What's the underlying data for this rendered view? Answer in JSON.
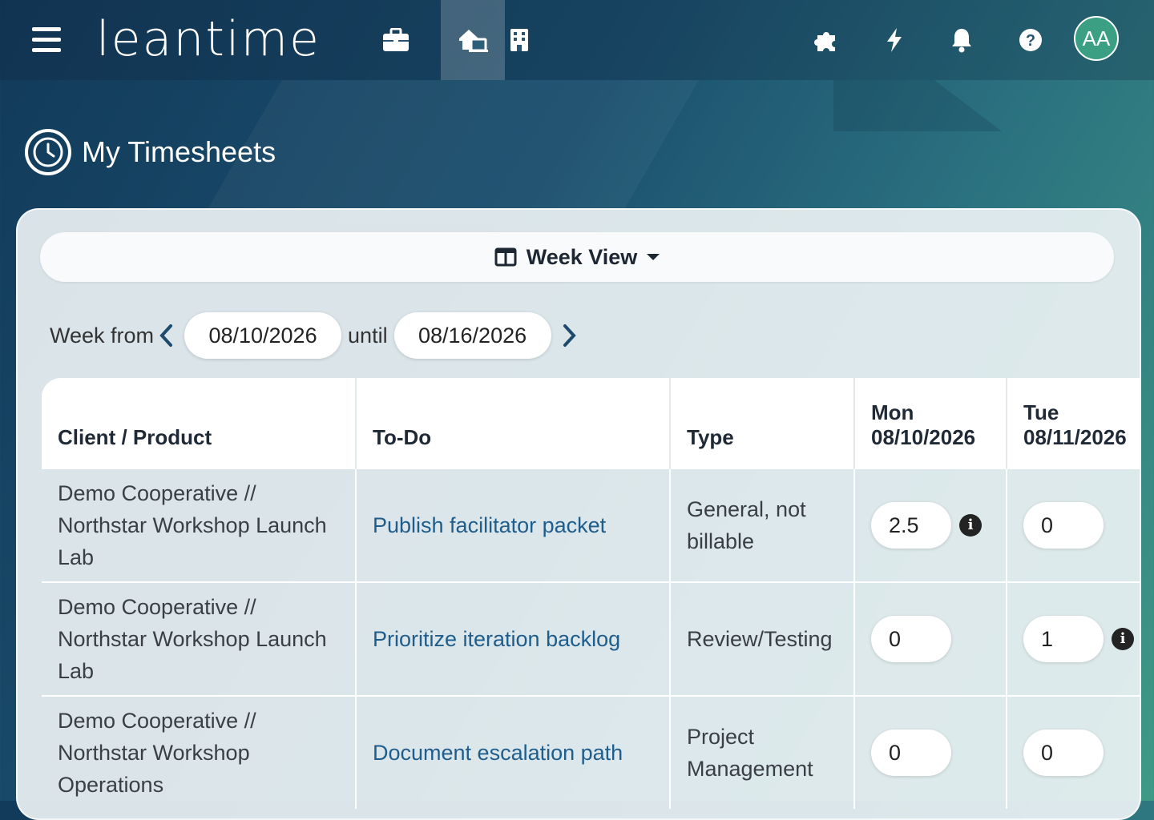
{
  "header": {
    "logo": "leantime",
    "avatar_initials": "AA",
    "nav": [
      {
        "icon": "briefcase-icon"
      },
      {
        "icon": "home-screen-icon",
        "active": true
      },
      {
        "icon": "building-icon"
      }
    ],
    "tools": [
      {
        "icon": "puzzle-icon"
      },
      {
        "icon": "lightning-icon"
      },
      {
        "icon": "bell-icon"
      },
      {
        "icon": "help-icon"
      }
    ]
  },
  "page": {
    "title": "My Timesheets",
    "view_label": "Week View",
    "week_from_label": "Week from",
    "until_label": "until",
    "week_from": "08/10/2026",
    "week_until": "08/16/2026"
  },
  "table": {
    "headers": {
      "client": "Client / Product",
      "todo": "To-Do",
      "type": "Type",
      "day1": "Mon",
      "day1_date": "08/10/2026",
      "day2": "Tue",
      "day2_date": "08/11/2026"
    },
    "rows": [
      {
        "client": "Demo Cooperative // Northstar Workshop Launch Lab",
        "todo": "Publish facilitator packet",
        "type": "General, not billable",
        "mon": "2.5",
        "tue": "0"
      },
      {
        "client": "Demo Cooperative // Northstar Workshop Launch Lab",
        "todo": "Prioritize iteration backlog",
        "type": "Review/Testing",
        "mon": "0",
        "tue": "1"
      },
      {
        "client": "Demo Cooperative // Northstar Workshop Operations",
        "todo": "Document escalation path",
        "type": "Project Management",
        "mon": "0",
        "tue": "0"
      }
    ]
  },
  "colors": {
    "accent": "#3ba083",
    "link": "#1e5d8c"
  }
}
